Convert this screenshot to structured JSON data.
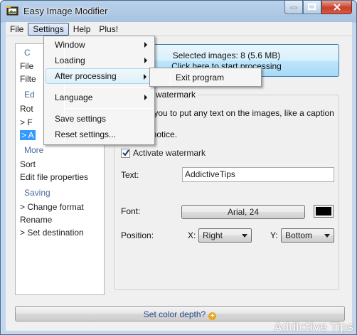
{
  "window": {
    "title": "Easy Image Modifier"
  },
  "menubar": {
    "items": [
      "File",
      "Settings",
      "Help",
      "Plus!"
    ]
  },
  "settings_menu": {
    "items": [
      {
        "label": "Window",
        "submenu": true
      },
      {
        "label": "Loading",
        "submenu": true
      },
      {
        "label": "After processing",
        "submenu": true
      },
      {
        "label": "Language",
        "submenu": true
      },
      {
        "label": "Save settings",
        "submenu": false
      },
      {
        "label": "Reset settings...",
        "submenu": false
      }
    ]
  },
  "after_processing_submenu": {
    "items": [
      "Exit program"
    ]
  },
  "left_panel": {
    "group1_header": "C",
    "group1_items": [
      "File",
      "Filte"
    ],
    "group2_header": "Ed",
    "group2_items": [
      "Rot",
      "> F",
      "> A"
    ],
    "more_header": "More",
    "more_items": [
      "Sort",
      "Edit file properties"
    ],
    "saving_header": "Saving",
    "saving_items": [
      "> Change format",
      "Rename",
      "> Set destination"
    ]
  },
  "selection": {
    "line1": "Selected images: 8  (5.6 MB)",
    "line2": "Click here to start processing"
  },
  "watermark_group": {
    "title": "d watermark",
    "description": "s you to put any text on the images, like a caption or\nt notice.",
    "activate_label": "Activate watermark",
    "activate_checked": true,
    "text_label": "Text:",
    "text_value": "AddictiveTips",
    "font_label": "Font:",
    "font_value": "Arial, 24",
    "font_color": "#000000",
    "position_label": "Position:",
    "x_label": "X:",
    "x_value": "Right",
    "y_label": "Y:",
    "y_value": "Bottom"
  },
  "bottom_bar": {
    "label": "Set color depth?"
  },
  "watermark_overlay": "Addictive Tips"
}
